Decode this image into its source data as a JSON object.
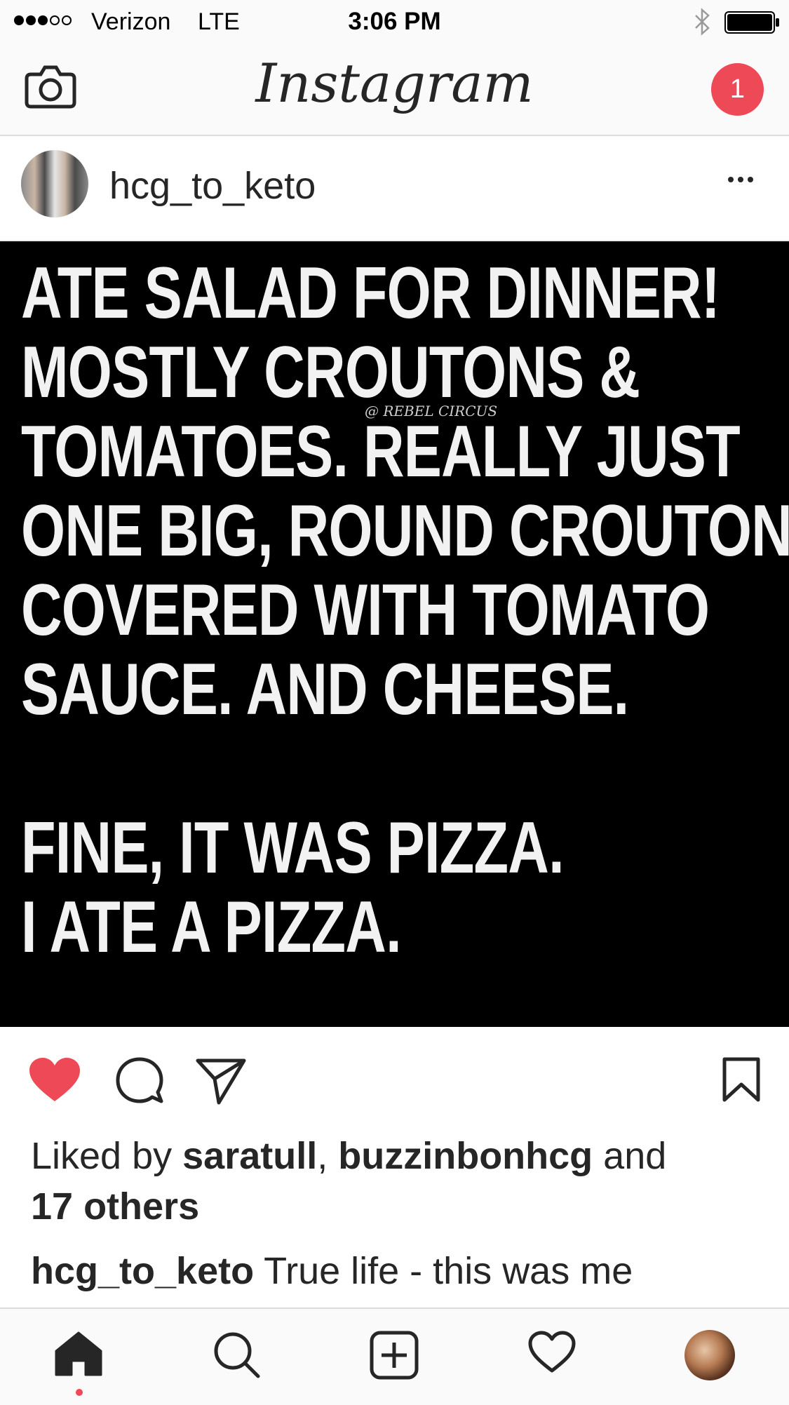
{
  "status_bar": {
    "carrier": "Verizon",
    "network": "LTE",
    "time": "3:06 PM",
    "signal_bars_filled": 3,
    "signal_bars_total": 5
  },
  "top_nav": {
    "brand": "Instagram",
    "notification_count": "1"
  },
  "post": {
    "username": "hcg_to_keto",
    "image_text_lines": [
      "ATE SALAD FOR DINNER!",
      "MOSTLY CROUTONS &",
      "TOMATOES.  REALLY JUST",
      "ONE BIG, ROUND CROUTON",
      "COVERED WITH TOMATO",
      "SAUCE.  AND CHEESE.",
      "",
      "FINE, IT WAS PIZZA.",
      "I ATE A PIZZA."
    ],
    "watermark": "@ REBEL CIRCUS",
    "liked": true,
    "likes": {
      "prefix": "Liked by ",
      "user1": "saratull",
      "separator": ", ",
      "user2": "buzzinbonhcg",
      "connector": " and",
      "others": "17 others"
    },
    "caption": {
      "username": "hcg_to_keto",
      "text": " True life - this was me"
    }
  },
  "colors": {
    "accent_red": "#ed4956",
    "text": "#262626",
    "bar_bg": "#fafafa"
  },
  "icons": {
    "top_left": "camera-icon",
    "post_menu": "more-icon",
    "actions": [
      "heart-icon",
      "comment-icon",
      "share-icon",
      "bookmark-icon"
    ],
    "tabs": [
      "home-icon",
      "search-icon",
      "new-post-icon",
      "activity-heart-icon",
      "profile-avatar"
    ]
  }
}
